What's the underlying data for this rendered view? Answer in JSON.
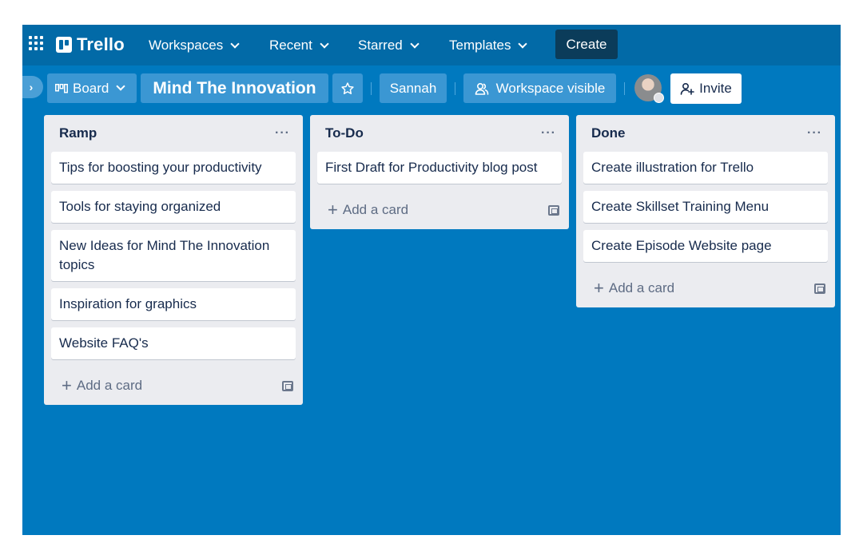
{
  "topbar": {
    "app_name": "Trello",
    "nav": [
      {
        "label": "Workspaces"
      },
      {
        "label": "Recent"
      },
      {
        "label": "Starred"
      },
      {
        "label": "Templates"
      }
    ],
    "create_label": "Create"
  },
  "boardbar": {
    "view_label": "Board",
    "board_title": "Mind The Innovation",
    "workspace_name": "Sannah",
    "visibility_label": "Workspace visible",
    "invite_label": "Invite"
  },
  "lists": [
    {
      "title": "Ramp",
      "cards": [
        {
          "title": "Tips for boosting your productivity"
        },
        {
          "title": "Tools for staying organized"
        },
        {
          "title": "New Ideas for Mind The Innovation topics"
        },
        {
          "title": "Inspiration for graphics"
        },
        {
          "title": "Website FAQ's"
        }
      ],
      "add_card_label": "Add a card"
    },
    {
      "title": "To-Do",
      "cards": [
        {
          "title": "First Draft for Productivity blog post"
        }
      ],
      "add_card_label": "Add a card"
    },
    {
      "title": "Done",
      "cards": [
        {
          "title": "Create illustration for Trello"
        },
        {
          "title": "Create Skillset Training Menu"
        },
        {
          "title": "Create Episode Website page"
        }
      ],
      "add_card_label": "Add a card"
    }
  ],
  "colors": {
    "board_background": "#0079bf",
    "header_background": "#026aa7",
    "create_button": "#0b3c5a",
    "list_background": "#ebecf0"
  },
  "icons": [
    "apps-grid-icon",
    "trello-logo-icon",
    "chevron-down-icon",
    "board-view-icon",
    "star-icon",
    "workspace-visible-icon",
    "add-member-icon",
    "plus-icon",
    "card-template-icon",
    "more-icon"
  ]
}
